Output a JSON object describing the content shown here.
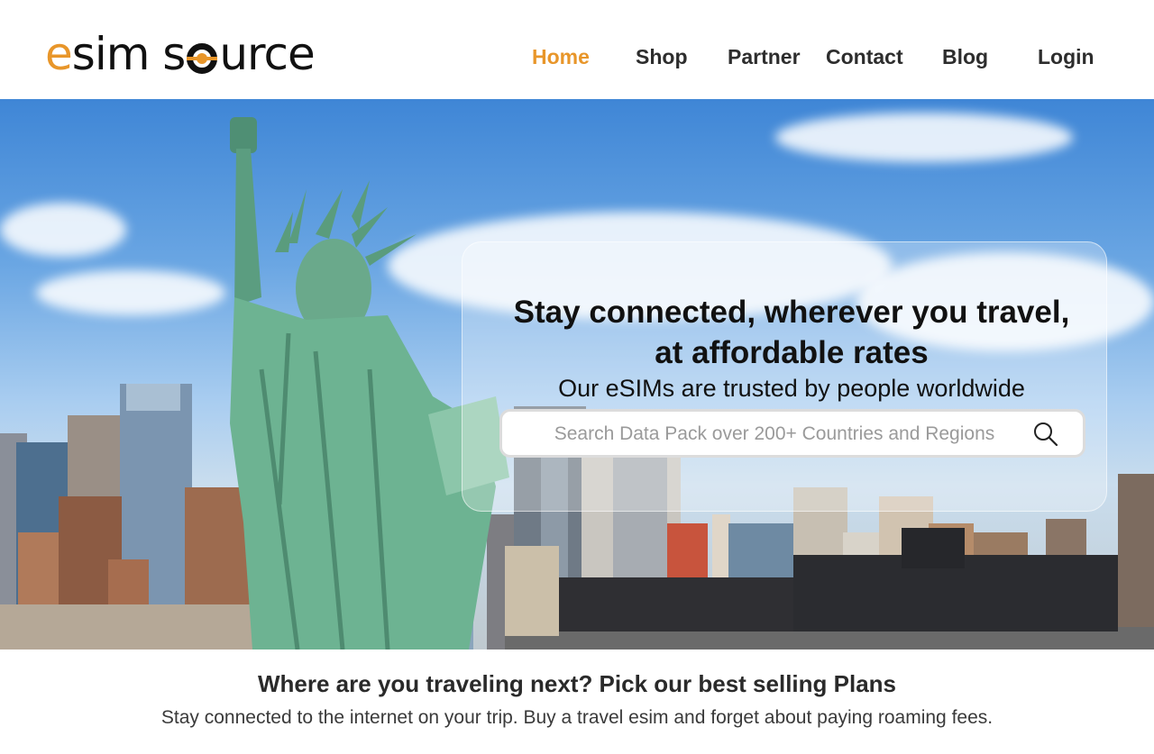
{
  "brand": {
    "logo_text_e": "e",
    "logo_text_sim": "sim s",
    "logo_text_urce": "urce",
    "accent_color": "#e8962a"
  },
  "nav": {
    "items": [
      {
        "label": "Home",
        "active": true
      },
      {
        "label": "Shop",
        "active": false
      },
      {
        "label": "Partner",
        "active": false
      },
      {
        "label": "Contact",
        "active": false
      },
      {
        "label": "Blog",
        "active": false
      },
      {
        "label": "Login",
        "active": false
      }
    ]
  },
  "hero": {
    "title_line1": "Stay connected, wherever you travel,",
    "title_line2": "at affordable rates",
    "subtitle": "Our eSIMs are trusted by people worldwide",
    "search": {
      "placeholder": "Search Data Pack over 200+ Countries and Regions",
      "value": ""
    },
    "search_icon": "search-icon"
  },
  "section": {
    "title": "Where are you traveling next? Pick our best selling Plans",
    "subtitle": "Stay connected to the internet on your trip. Buy a travel esim and forget about paying roaming fees."
  }
}
